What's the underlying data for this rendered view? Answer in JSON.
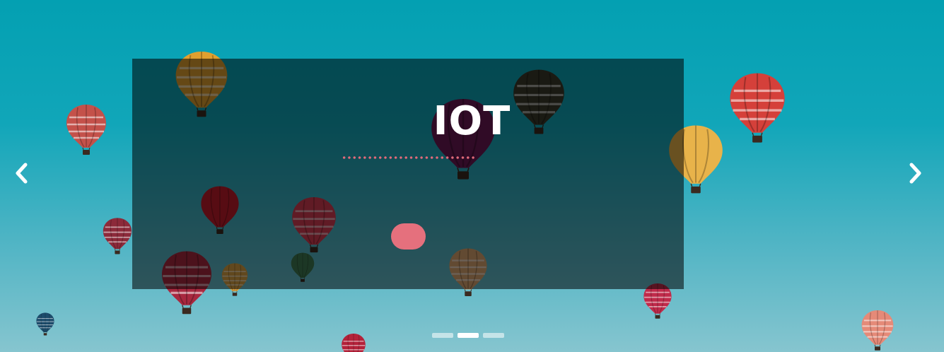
{
  "slider": {
    "caption": {
      "title": "IOT",
      "button_label": ""
    },
    "navigation": {
      "prev_icon": "chevron-left-icon",
      "next_icon": "chevron-right-icon"
    },
    "indicators": {
      "count": 3,
      "active_index": 1
    },
    "background_image": "hot-air-balloons-in-teal-sky"
  },
  "colors": {
    "sky_top": "#03a0b2",
    "sky_bottom": "#86c5cf",
    "overlay": "#000000",
    "accent": "#e5707d",
    "text": "#ffffff"
  }
}
